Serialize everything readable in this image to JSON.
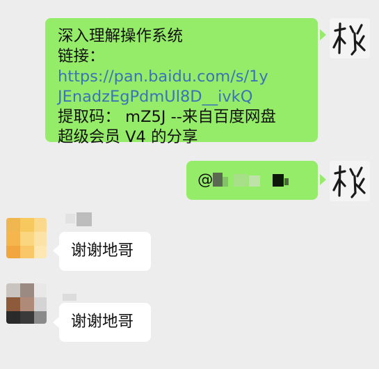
{
  "messages": [
    {
      "sender": "self",
      "line1": "深入理解操作系统",
      "link_label": "链接：",
      "link_url_part1": "https://pan.baidu.com/s/1y",
      "link_url_part2": "JEnadzEgPdmUl8D__ivkQ",
      "line4": "提取码：  mZ5J --来自百度网盘",
      "line5": "超级会员 V4 的分享"
    },
    {
      "sender": "self",
      "mention_prefix": "@"
    },
    {
      "sender": "other",
      "text": "谢谢地哥"
    },
    {
      "sender": "other",
      "text": "谢谢地哥"
    }
  ],
  "self_avatar": {
    "icon": "calligraphy-avatar-icon",
    "glyph": "秋"
  },
  "colors": {
    "self_bubble": "#95ec69",
    "other_bubble": "#ffffff",
    "background": "#ededed",
    "link": "#3a73b8"
  }
}
